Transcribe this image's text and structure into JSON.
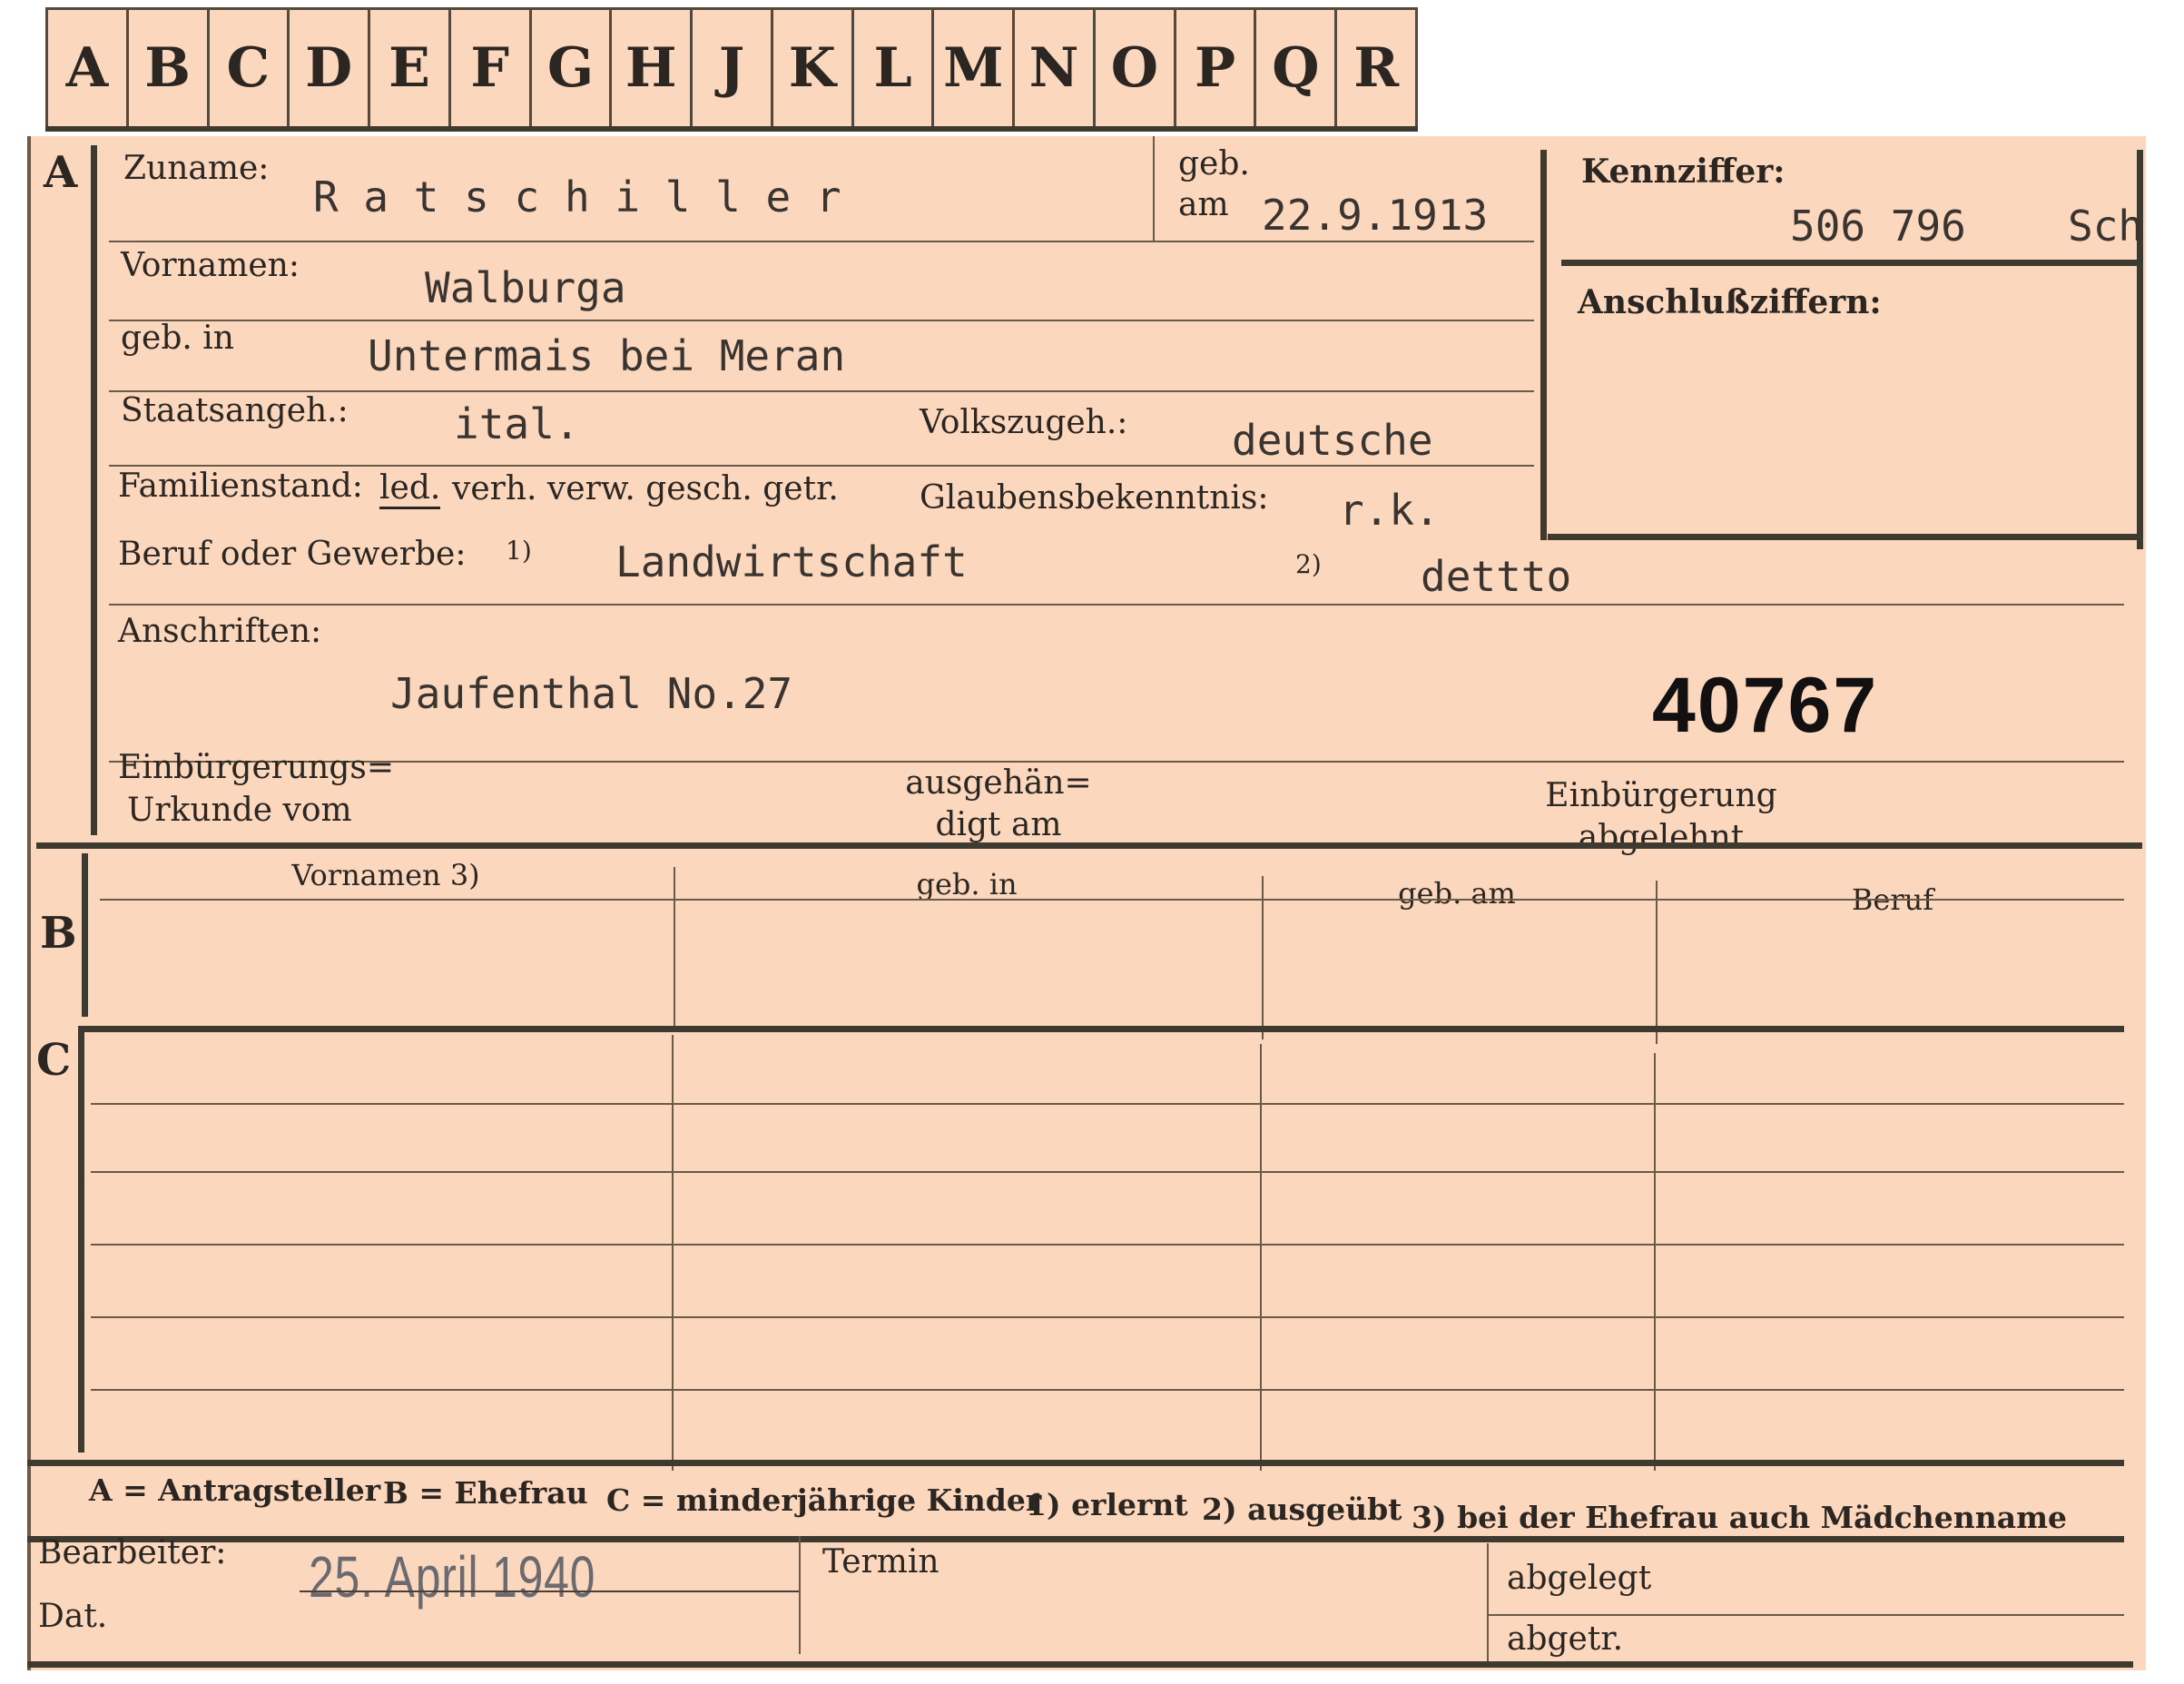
{
  "tabs": [
    "A",
    "B",
    "C",
    "D",
    "E",
    "F",
    "G",
    "H",
    "J",
    "K",
    "L",
    "M",
    "N",
    "O",
    "P",
    "Q",
    "R"
  ],
  "sections": {
    "a": "A",
    "b": "B",
    "c": "C"
  },
  "labels": {
    "zuname": "Zuname:",
    "geb": "geb.",
    "am": "am",
    "vornamen": "Vornamen:",
    "geb_in": "geb. in",
    "staatsangeh": "Staatsangeh.:",
    "volkszugeh": "Volkszugeh.:",
    "familienstand": "Familienstand:",
    "fs_led": "led.",
    "fs_rest": "verh. verw. gesch. getr.",
    "glaubensbekenntnis": "Glaubensbekenntnis:",
    "beruf": "Beruf oder Gewerbe:",
    "note1": "1)",
    "note2": "2)",
    "anschriften": "Anschriften:",
    "einb_line1": "Einbürgerungs=",
    "einb_line2": "Urkunde vom",
    "ausgeh_line1": "ausgehän=",
    "ausgeh_line2": "digt am",
    "abgelehnt_line1": "Einbürgerung",
    "abgelehnt_line2": "abgelehnt",
    "kennziffer": "Kennziffer:",
    "anschlussziffern": "Anschlußziffern:"
  },
  "values": {
    "zuname": "R a t s c h i l l e r",
    "geb_am": "22.9.1913",
    "kennziffer": "506 796",
    "kennziffer_suffix": "Sch",
    "vornamen": "Walburga",
    "geb_in": "Untermais bei Meran",
    "staatsangeh": "ital.",
    "volkszugeh": "deutsche",
    "glaubensbekenntnis": "r.k.",
    "beruf_erlernt": "Landwirtschaft",
    "beruf_ausgeuebt": "dettto",
    "anschrift": "Jaufenthal  No.27",
    "aktenzahl": "40767"
  },
  "table_headers": {
    "vornamen": "Vornamen 3)",
    "geb_in": "geb. in",
    "geb_am": "geb. am",
    "beruf": "Beruf"
  },
  "legend": {
    "a": "A = Antragsteller",
    "b": "B = Ehefrau",
    "c": "C = minderjährige Kinder",
    "n1": "1) erlernt",
    "n2": "2) ausgeübt",
    "n3": "3) bei der Ehefrau auch Mädchenname"
  },
  "footer": {
    "bearbeiter": "Bearbeiter:",
    "dat": "Dat.",
    "date_stamp": "25. April 1940",
    "termin": "Termin",
    "abgelegt": "abgelegt",
    "abgetr": "abgetr."
  }
}
